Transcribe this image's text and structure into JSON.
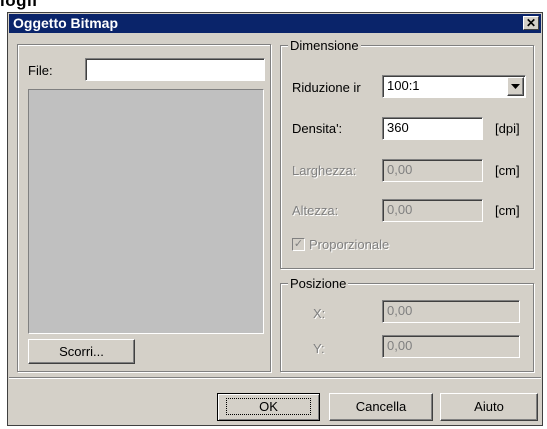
{
  "top_fragment": "iogli",
  "window": {
    "title": "Oggetto Bitmap",
    "close_glyph": "✕"
  },
  "left": {
    "file_label": "File:",
    "file_value": "",
    "browse_label": "Scorri..."
  },
  "dimension": {
    "legend": "Dimensione",
    "reduction_label": "Riduzione ir",
    "reduction_value": "100:1",
    "density_label": "Densita':",
    "density_value": "360",
    "density_unit": "[dpi]",
    "width_label": "Larghezza:",
    "width_value": "0,00",
    "width_unit": "[cm]",
    "height_label": "Altezza:",
    "height_value": "0,00",
    "height_unit": "[cm]",
    "proportional_label": "Proporzionale",
    "proportional_checked": true
  },
  "position": {
    "legend": "Posizione",
    "x_label": "X:",
    "x_value": "0,00",
    "y_label": "Y:",
    "y_value": "0,00"
  },
  "buttons": {
    "ok": "OK",
    "cancel": "Cancella",
    "help": "Aiuto"
  },
  "colors": {
    "title_bar": "#0a246a",
    "face": "#d4d0c8"
  }
}
